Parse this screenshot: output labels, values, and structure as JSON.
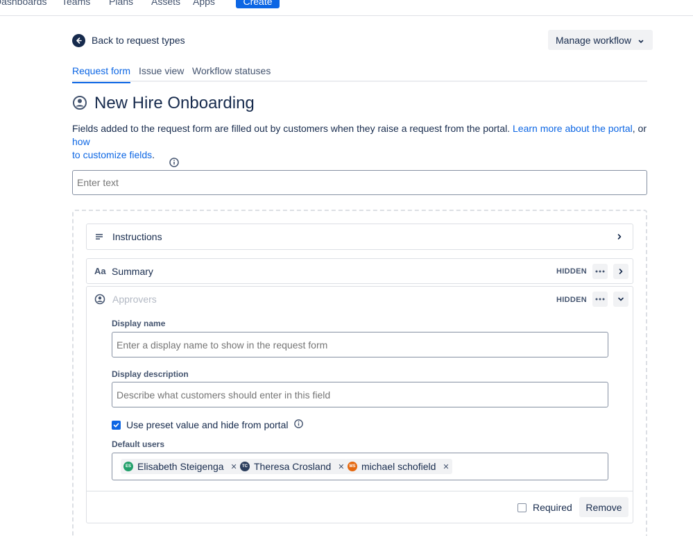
{
  "topnav": {
    "items": [
      "Dashboards",
      "Teams",
      "Plans",
      "Assets",
      "Apps"
    ],
    "create_label": "Create"
  },
  "back": {
    "label": "Back to request types"
  },
  "manage_workflow": {
    "label": "Manage workflow"
  },
  "tabs": [
    {
      "label": "Request form",
      "active": true
    },
    {
      "label": "Issue view",
      "active": false
    },
    {
      "label": "Workflow statuses",
      "active": false
    }
  ],
  "page": {
    "title": "New Hire Onboarding",
    "description_text": "Fields added to the request form are filled out by customers when they raise a request from the portal. ",
    "link_learn_more": "Learn more about the portal",
    "description_or": ", or ",
    "link_customize_1": "how",
    "link_customize_2": "to customize fields",
    "description_end": ".",
    "enter_text_placeholder": "Enter text"
  },
  "fields": {
    "instructions": {
      "label": "Instructions"
    },
    "summary": {
      "label": "Summary",
      "badge": "HIDDEN"
    },
    "approvers": {
      "label": "Approvers",
      "badge": "HIDDEN",
      "display_name_label": "Display name",
      "display_name_placeholder": "Enter a display name to show in the request form",
      "display_description_label": "Display description",
      "display_description_placeholder": "Describe what customers should enter in this field",
      "preset_label": "Use preset value and hide from portal",
      "preset_checked": true,
      "default_users_label": "Default users",
      "users": [
        {
          "name": "Elisabeth Steigenga",
          "initials": "ES",
          "color": "#22a06b"
        },
        {
          "name": "Theresa Crosland",
          "initials": "TC",
          "color": "#2c3e5d"
        },
        {
          "name": "michael schofield",
          "initials": "MS",
          "color": "#e56910"
        }
      ],
      "required_label": "Required",
      "required_checked": false,
      "remove_label": "Remove"
    }
  },
  "colors": {
    "accent": "#0c66e4",
    "text": "#172b4d",
    "subtle": "#44546f"
  }
}
